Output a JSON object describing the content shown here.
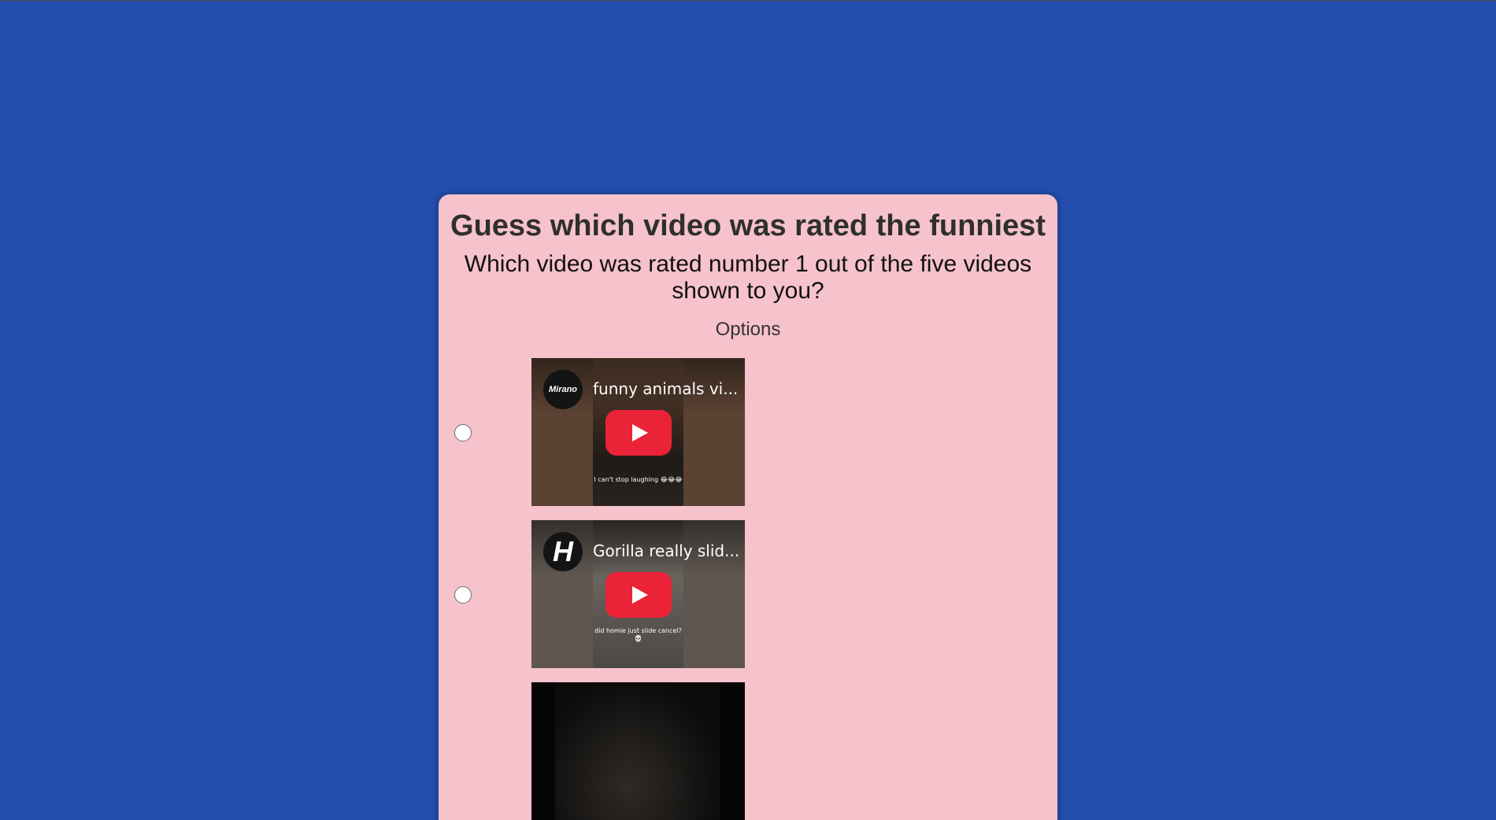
{
  "page": {
    "title": "Guess which video was rated the funniest",
    "question": "Which video was rated number 1 out of the five videos shown to you?",
    "options_label": "Options"
  },
  "colors": {
    "background": "#234ead",
    "card": "#f6c2cc",
    "play_button": "#ea2338"
  },
  "options": [
    {
      "channel": "Mirano",
      "video_title": "funny animals vi...",
      "caption": "I can't stop laughing 😂😂😂",
      "icon": "youtube-play-icon"
    },
    {
      "channel": "H",
      "video_title": "Gorilla really slid...",
      "caption": "did homie just slide cancel? 💀",
      "icon": "youtube-play-icon"
    },
    {
      "channel": "",
      "video_title": "",
      "caption": "",
      "icon": "video-thumbnail"
    }
  ]
}
